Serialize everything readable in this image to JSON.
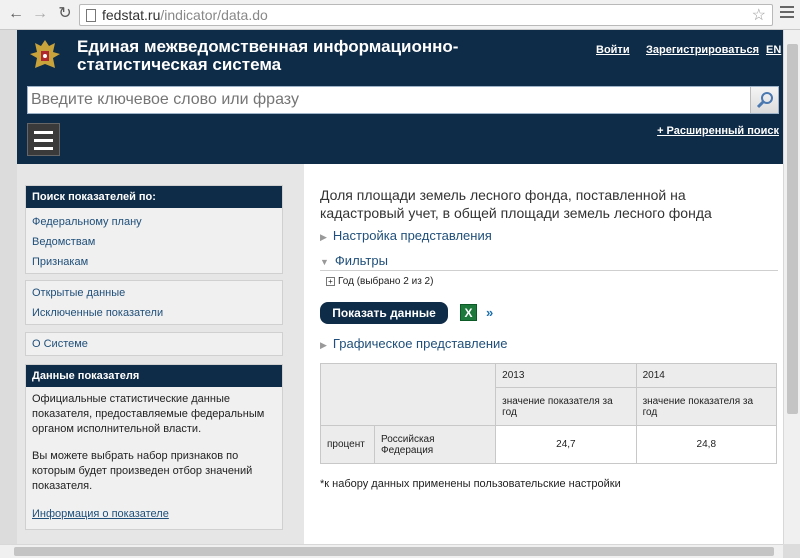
{
  "browser": {
    "url_host": "fedstat.ru",
    "url_path": "/indicator/data.do"
  },
  "header": {
    "title": "Единая межведомственная информационно-статистическая система",
    "login": "Войти",
    "register": "Зарегистрироваться",
    "lang": "EN",
    "search_placeholder": "Введите ключевое слово или фразу",
    "advanced_search": "+ Расширенный поиск"
  },
  "sidebar": {
    "search_head": "Поиск показателей по:",
    "search_items": [
      "Федеральному плану",
      "Ведомствам",
      "Признакам"
    ],
    "data_items": [
      "Открытые данные",
      "Исключенные показатели"
    ],
    "about": "О Системе",
    "indicator_head": "Данные показателя",
    "indicator_text1": "Официальные статистические данные показателя, предоставляемые федеральным органом исполнительной власти.",
    "indicator_text2": "Вы можете выбрать набор признаков по которым будет произведен отбор значений показателя.",
    "indicator_link": "Информация о показателе"
  },
  "main": {
    "title": "Доля площади земель лесного фонда, поставленной на кадастровый учет, в общей площади земель лесного фонда",
    "view_settings": "Настройка представления",
    "filters": "Фильтры",
    "year_filter": "Год",
    "year_selected": "(выбрано 2 из 2)",
    "show_data_button": "Показать данные",
    "chart_view": "Графическое представление",
    "note": "*к набору данных применены пользовательские настройки"
  },
  "table": {
    "years": [
      "2013",
      "2014"
    ],
    "measure": "значение показателя за год",
    "unit": "процент",
    "region": "Российская Федерация",
    "values": [
      "24,7",
      "24,8"
    ]
  }
}
